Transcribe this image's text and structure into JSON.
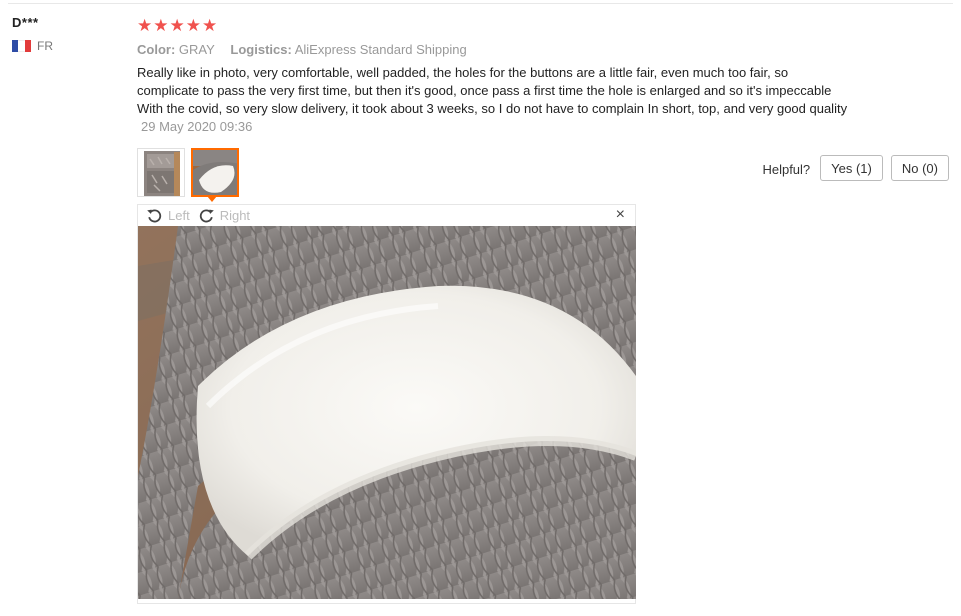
{
  "review": {
    "user_name": "D***",
    "country": "FR",
    "rating_stars": 5,
    "star_glyph": "★",
    "color_label": "Color:",
    "color_value": "GRAY",
    "logistics_label": "Logistics:",
    "logistics_value": "AliExpress Standard Shipping",
    "text": "Really like in photo, very comfortable, well padded, the holes for the buttons are a little fair, even much too fair, so complicate to pass the very first time, but then it's good, once pass a first time the hole is enlarged and so it's impeccable With the covid, so very slow delivery, it took about 3 weeks, so I do not have to complain In short, top, and very good quality",
    "date": "29 May 2020 09:36"
  },
  "helpful": {
    "label": "Helpful?",
    "yes_label": "Yes (1)",
    "no_label": "No (0)"
  },
  "viewer": {
    "rotate_left_label": "Left",
    "rotate_right_label": "Right",
    "close_glyph": "×"
  },
  "colors": {
    "star": "#f0524e",
    "accent_orange": "#ff6a00",
    "flag_blue": "#2e4ca6",
    "flag_white": "#ffffff",
    "flag_red": "#e23b3b"
  },
  "icons": {
    "rotate_left": "rotate-left-icon",
    "rotate_right": "rotate-right-icon",
    "close": "close-icon",
    "star": "star-icon",
    "flag": "france-flag-icon"
  }
}
